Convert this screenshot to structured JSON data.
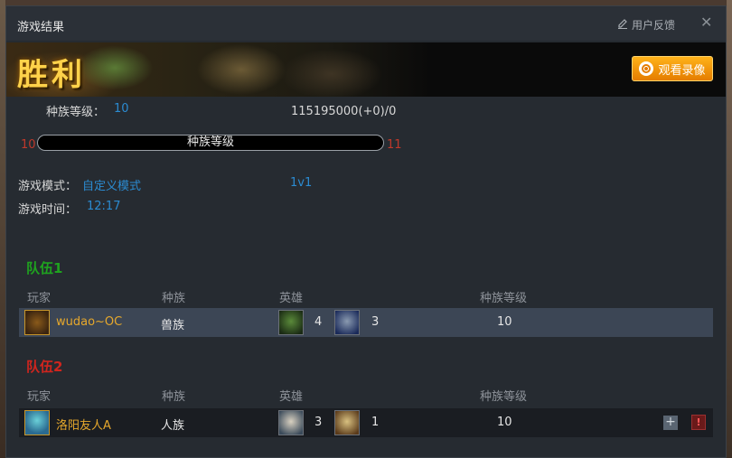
{
  "window": {
    "title": "游戏结果",
    "feedback_label": "用户反馈",
    "close_glyph": "✕"
  },
  "banner": {
    "result": "胜利",
    "replay_label": "观看录像"
  },
  "stats": {
    "race_level_label": "种族等级：",
    "race_level_value": "10",
    "score": "115195000(+0)/0",
    "progress": {
      "current_level": "10",
      "next_level": "11",
      "bar_label": "种族等级",
      "fill_fraction": 0
    },
    "mode_label": "游戏模式：",
    "mode_value": "自定义模式",
    "format_value": "1v1",
    "time_label": "游戏时间：",
    "time_value": "12:17"
  },
  "columns": {
    "player": "玩家",
    "race": "种族",
    "hero": "英雄",
    "race_level": "种族等级"
  },
  "teams": [
    {
      "title": "队伍1",
      "color": "#1fa31f",
      "players": [
        {
          "name": "wudao~OC",
          "race": "兽族",
          "heroes": [
            {
              "icon": "orc-hero-blademaster-icon",
              "level": "4"
            },
            {
              "icon": "orc-hero-farseer-icon",
              "level": "3"
            }
          ],
          "race_level": "10"
        }
      ]
    },
    {
      "title": "队伍2",
      "color": "#d0251e",
      "players": [
        {
          "name": "洛阳友人A",
          "race": "人族",
          "heroes": [
            {
              "icon": "human-hero-archmage-icon",
              "level": "3"
            },
            {
              "icon": "human-hero-mountain-king-icon",
              "level": "1"
            }
          ],
          "race_level": "10"
        }
      ]
    }
  ],
  "actions": {
    "add_friend_glyph": "+",
    "report_glyph": "!"
  }
}
